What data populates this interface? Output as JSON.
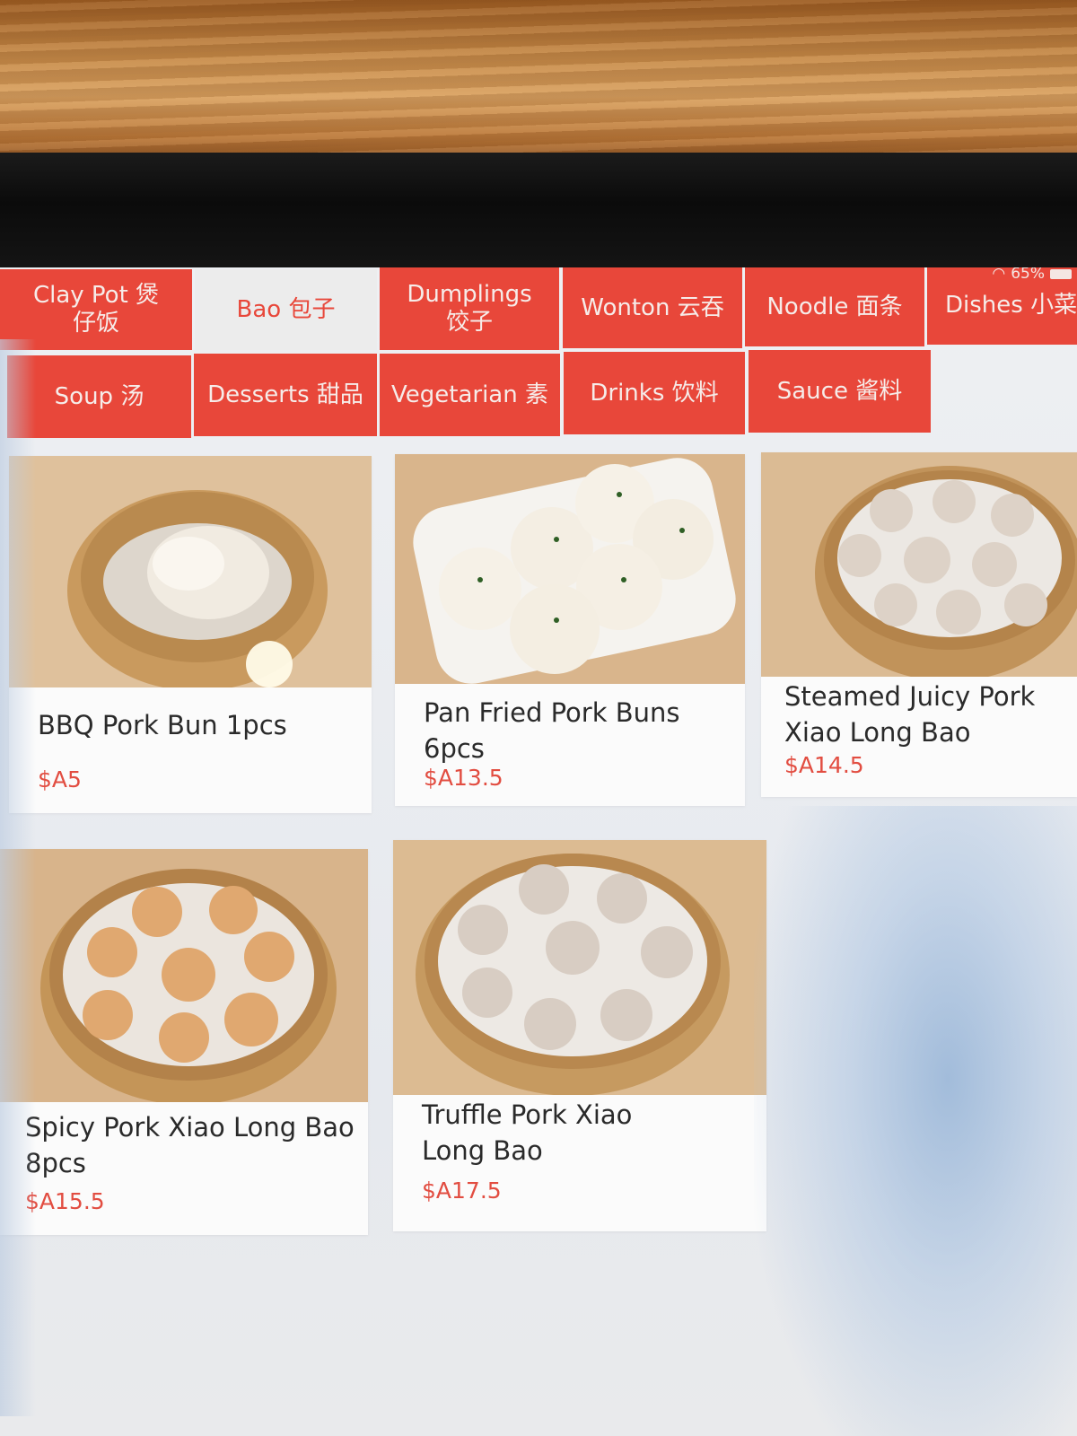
{
  "status_bar": {
    "battery": "65%"
  },
  "categories": [
    {
      "label": "Clay Pot 煲\n仔饭",
      "active": false
    },
    {
      "label": "Bao 包子",
      "active": true
    },
    {
      "label": "Dumplings\n饺子",
      "active": false
    },
    {
      "label": "Wonton 云吞",
      "active": false
    },
    {
      "label": "Noodle 面条",
      "active": false
    },
    {
      "label": "Dishes 小菜",
      "active": false
    },
    {
      "label": "Soup 汤",
      "active": false
    },
    {
      "label": "Desserts 甜品",
      "active": false
    },
    {
      "label": "Vegetarian 素",
      "active": false
    },
    {
      "label": "Drinks 饮料",
      "active": false
    },
    {
      "label": "Sauce 酱料",
      "active": false
    }
  ],
  "products": [
    {
      "name": "BBQ Pork Bun 1pcs",
      "price": "$A5"
    },
    {
      "name": "Pan Fried Pork Buns 6pcs",
      "price": "$A13.5"
    },
    {
      "name": "Steamed Juicy Pork Xiao Long Bao",
      "price": "$A14.5"
    },
    {
      "name": "Spicy Pork Xiao Long Bao 8pcs",
      "price": "$A15.5"
    },
    {
      "name": "Truffle Pork Xiao Long Bao",
      "price": "$A17.5"
    }
  ],
  "colors": {
    "accent": "#e8473a",
    "price": "#e24d41"
  }
}
